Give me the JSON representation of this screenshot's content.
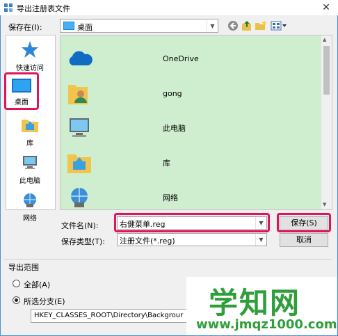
{
  "window": {
    "title": "导出注册表文件",
    "close_glyph": "✕"
  },
  "toolbar": {
    "save_in_label": "保存在(I):",
    "location": "桌面",
    "icons": [
      "back-icon",
      "up-folder-icon",
      "new-folder-icon",
      "view-menu-icon"
    ]
  },
  "places": [
    {
      "label": "快速访问",
      "icon": "star-icon"
    },
    {
      "label": "桌面",
      "icon": "desktop-icon"
    },
    {
      "label": "库",
      "icon": "library-icon"
    },
    {
      "label": "此电脑",
      "icon": "computer-icon"
    },
    {
      "label": "网络",
      "icon": "network-icon"
    }
  ],
  "files": [
    {
      "name": "OneDrive",
      "icon": "onedrive-icon"
    },
    {
      "name": "gong",
      "icon": "user-folder-icon"
    },
    {
      "name": "此电脑",
      "icon": "computer-icon"
    },
    {
      "name": "库",
      "icon": "library-icon"
    },
    {
      "name": "网络",
      "icon": "network-icon"
    }
  ],
  "form": {
    "filename_label": "文件名(N):",
    "filename_value": "右健菜单.reg",
    "filetype_label": "保存类型(T):",
    "filetype_value": "注册文件(*.reg)",
    "save_button": "保存(S)",
    "cancel_button": "取消"
  },
  "export_range": {
    "title": "导出范围",
    "all_label": "全部(A)",
    "branch_label": "所选分支(E)",
    "branch_path": "HKEY_CLASSES_ROOT\\Directory\\Backgrour",
    "selected": "branch"
  },
  "watermark": {
    "big": "学知网",
    "small": "www.jmqz1000.com"
  },
  "colors": {
    "highlight": "#e0145a",
    "list_bg": "#cfeecf",
    "watermark": "#2f9e3b"
  }
}
